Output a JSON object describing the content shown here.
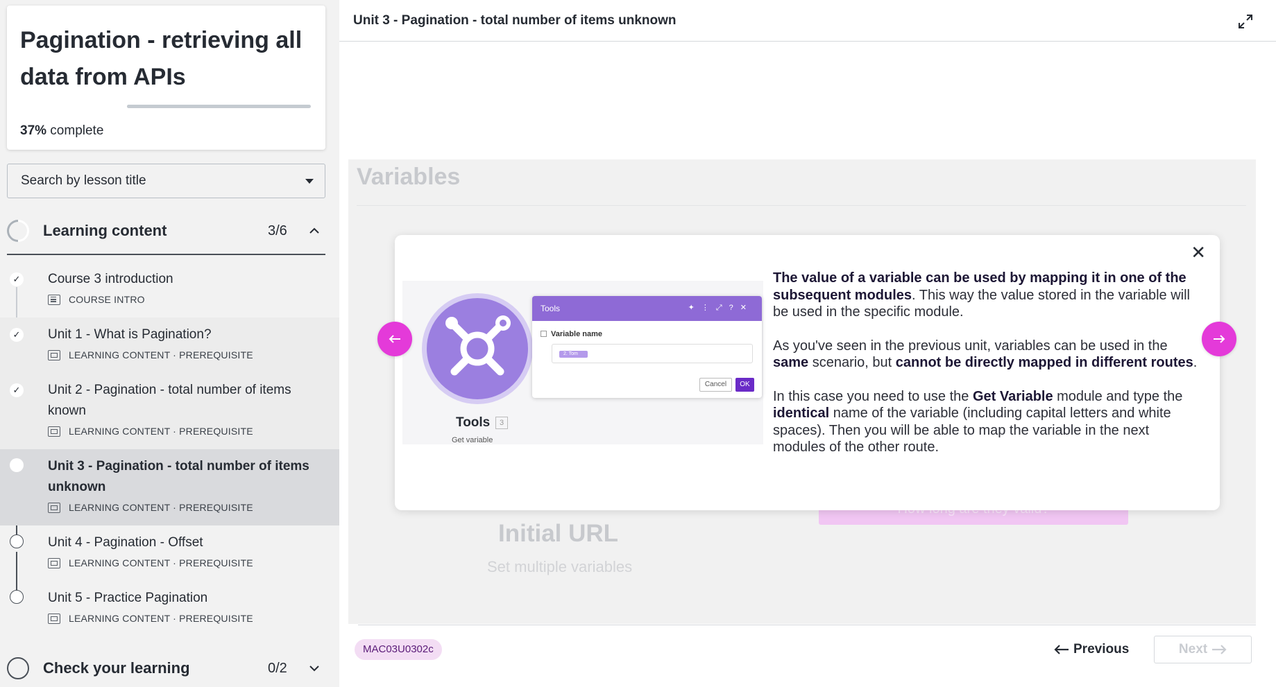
{
  "course": {
    "title": "Pagination - retrieving all data from APIs",
    "progress_percent": "37%",
    "progress_suffix": " complete",
    "progress_value": 0.37
  },
  "search": {
    "placeholder": "Search by lesson title"
  },
  "sections": [
    {
      "label": "Learning content",
      "count": "3/6",
      "expanded": true,
      "lessons": [
        {
          "title": "Course 3 introduction",
          "meta": "COURSE INTRO",
          "status": "done",
          "icon": "doc-icon"
        },
        {
          "title": "Unit 1 - What is Pagination?",
          "meta": "LEARNING CONTENT · PREREQUISITE",
          "status": "done",
          "icon": "slides-icon"
        },
        {
          "title": "Unit 2 - Pagination - total number of items known",
          "meta": "LEARNING CONTENT · PREREQUISITE",
          "status": "done",
          "icon": "slides-icon"
        },
        {
          "title": "Unit 3 - Pagination - total number of items unknown",
          "meta": "LEARNING CONTENT · PREREQUISITE",
          "status": "current",
          "icon": "slides-icon"
        },
        {
          "title": "Unit 4 - Pagination - Offset",
          "meta": "LEARNING CONTENT · PREREQUISITE",
          "status": "open",
          "icon": "slides-icon"
        },
        {
          "title": "Unit 5 - Practice Pagination",
          "meta": "LEARNING CONTENT · PREREQUISITE",
          "status": "open",
          "icon": "slides-icon"
        }
      ]
    },
    {
      "label": "Check your learning",
      "count": "0/2",
      "expanded": false
    }
  ],
  "main": {
    "header_title": "Unit 3 - Pagination - total number of items unknown",
    "stage": {
      "title": "Variables",
      "initial_url": "Initial URL",
      "set_multiple": "Set multiple variables",
      "pink_button": "How long are they valid?"
    },
    "modal": {
      "close": "✕",
      "p1_bold": "The value of a variable can be used by mapping it in one of the subsequent modules",
      "p1_rest": ". This way the value stored in the variable will be used in the specific module.",
      "p2_a": "As you've seen in the previous unit, variables can be used in the ",
      "p2_b": "same",
      "p2_c": " scenario, but ",
      "p2_d": "cannot be directly mapped in different routes",
      "p2_e": ".",
      "p3_a": "In this case you need to use the ",
      "p3_b": "Get Variable",
      "p3_c": " module and type the ",
      "p3_d": "identical",
      "p3_e": " name of the variable (including capital letters and white spaces). Then you will be able to map the variable in the next modules of the other route.",
      "illustration": {
        "module_label": "Tools",
        "module_number": "3",
        "module_sub": "Get variable",
        "dialog_title": "Tools",
        "field_label": "Variable name",
        "pill_text": "2. Tom",
        "cancel": "Cancel",
        "ok": "OK"
      }
    },
    "footer": {
      "code": "MAC03U0302c",
      "previous": "Previous",
      "next": "Next"
    }
  },
  "colors": {
    "accent_pink": "#e43ad9",
    "accent_purple": "#8e6ad6",
    "badge_bg": "#f3ddf4"
  }
}
